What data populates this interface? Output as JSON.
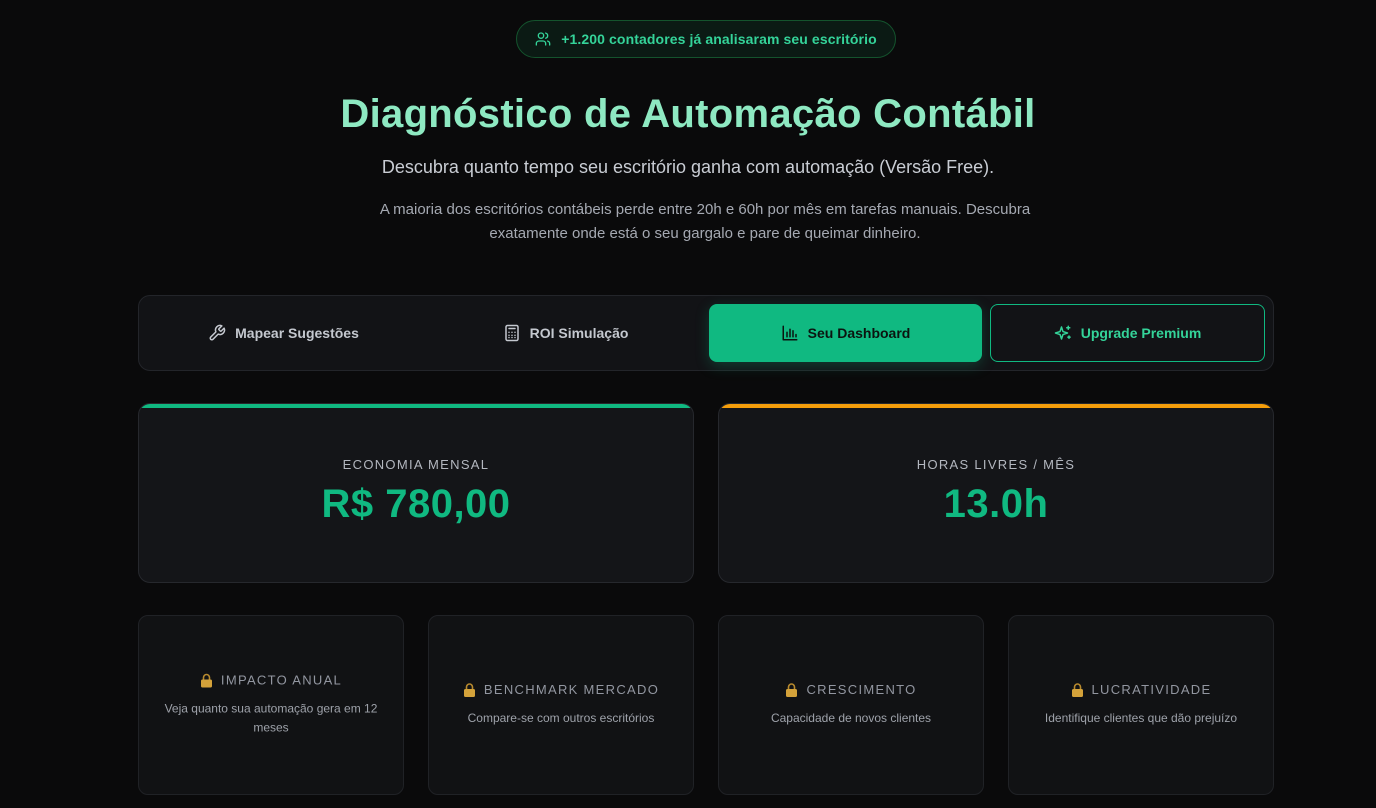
{
  "badge": {
    "text": "+1.200 contadores já analisaram seu escritório",
    "icon": "users-icon"
  },
  "header": {
    "title": "Diagnóstico de Automação Contábil",
    "subtitle": "Descubra quanto tempo seu escritório ganha com automação (Versão Free).",
    "description": "A maioria dos escritórios contábeis perde entre 20h e 60h por mês em tarefas manuais. Descubra exatamente onde está o seu gargalo e pare de queimar dinheiro."
  },
  "tabs": [
    {
      "label": "Mapear Sugestões",
      "icon": "wrench-icon",
      "active": false
    },
    {
      "label": "ROI Simulação",
      "icon": "calculator-icon",
      "active": false
    },
    {
      "label": "Seu Dashboard",
      "icon": "bar-chart-icon",
      "active": true
    },
    {
      "label": "Upgrade Premium",
      "icon": "sparkles-icon",
      "active": false
    }
  ],
  "stats": {
    "economia": {
      "label": "ECONOMIA MENSAL",
      "value": "R$ 780,00",
      "accent": "#10b981"
    },
    "horas": {
      "label": "HORAS LIVRES / MÊS",
      "value": "13.0h",
      "accent": "#f59e0b"
    }
  },
  "locked": [
    {
      "title": "IMPACTO ANUAL",
      "text": "Veja quanto sua automação gera em 12 meses",
      "icon": "lock-icon"
    },
    {
      "title": "BENCHMARK MERCADO",
      "text": "Compare-se com outros escritórios",
      "icon": "lock-icon"
    },
    {
      "title": "CRESCIMENTO",
      "text": "Capacidade de novos clientes",
      "icon": "lock-icon"
    },
    {
      "title": "LUCRATIVIDADE",
      "text": "Identifique clientes que dão prejuízo",
      "icon": "lock-icon"
    }
  ],
  "colors": {
    "accent": "#10b981",
    "warning": "#f59e0b",
    "background": "#0a0a0b"
  }
}
